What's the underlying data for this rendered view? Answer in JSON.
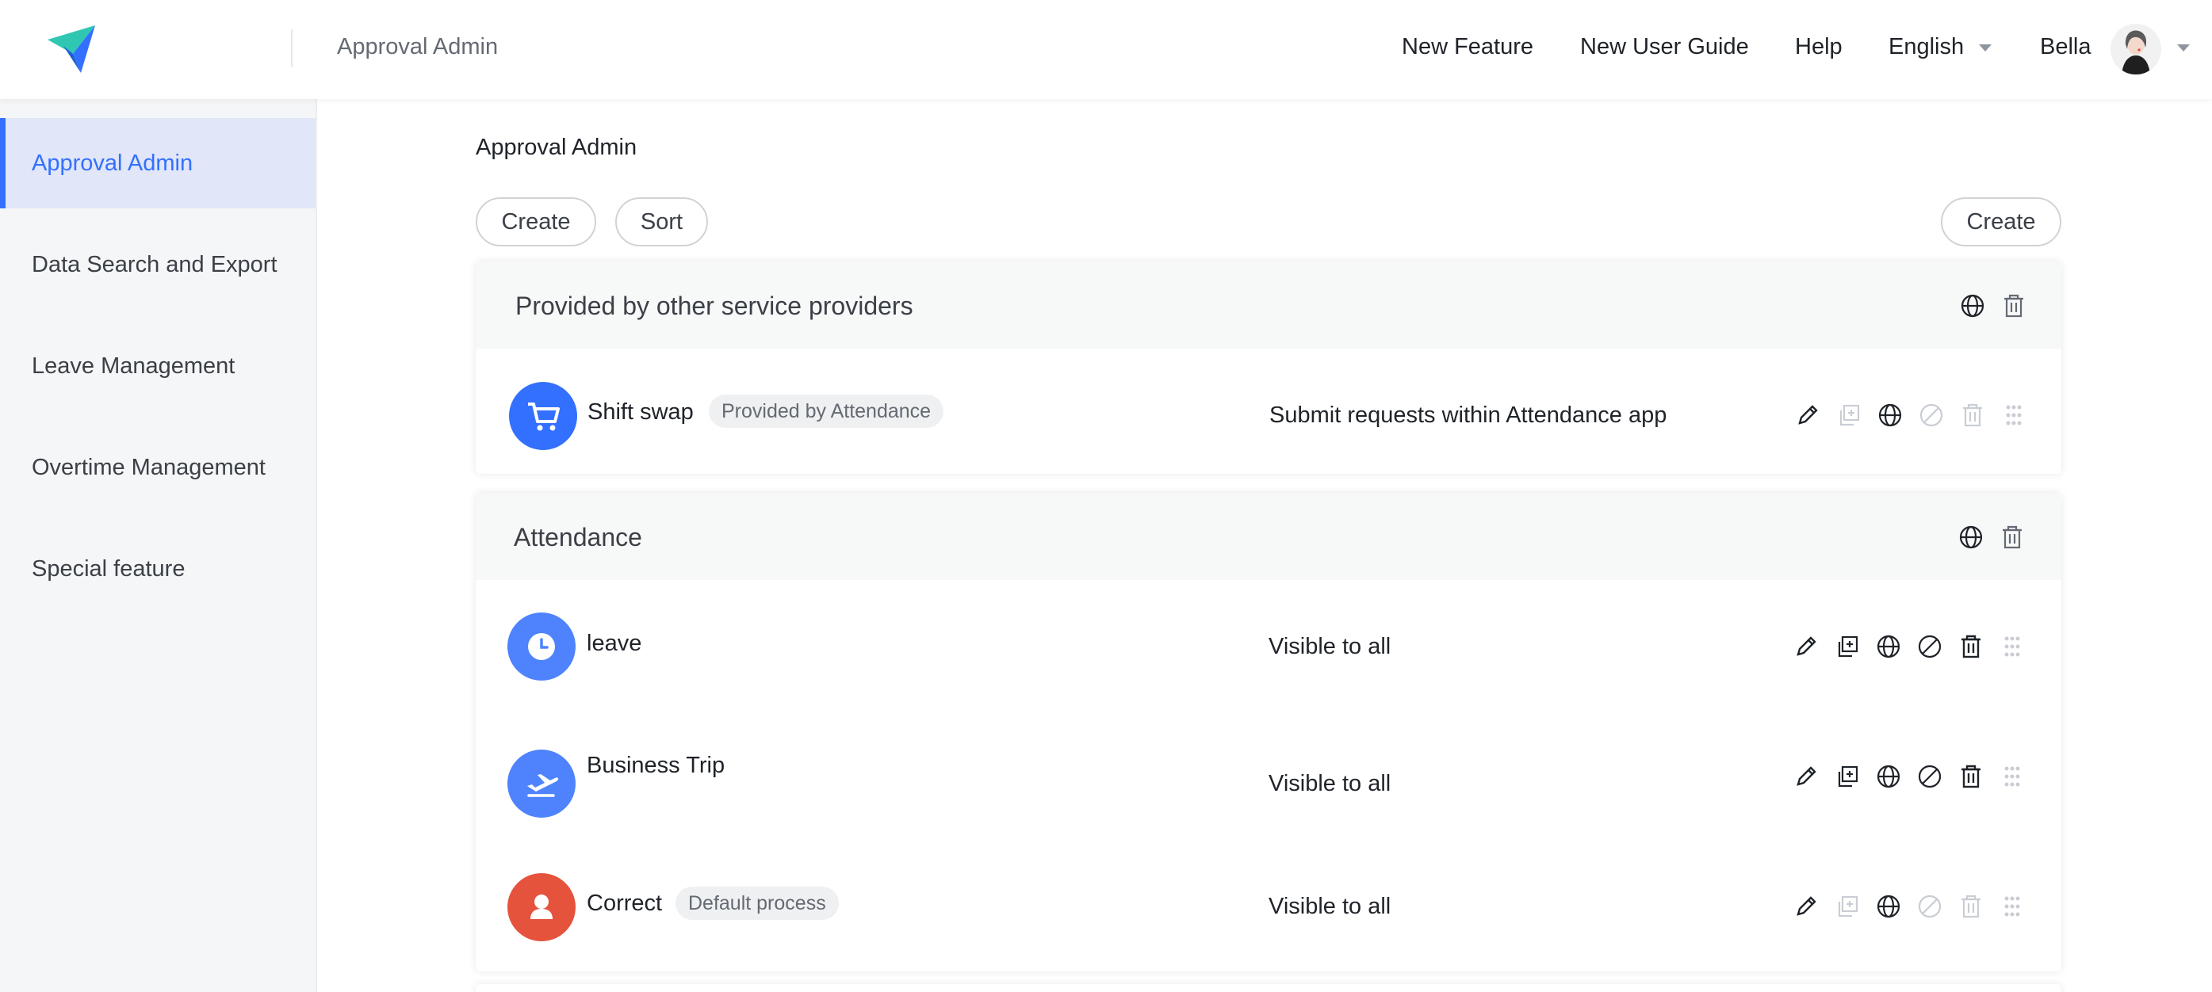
{
  "header": {
    "app_title": "Approval Admin",
    "nav": {
      "new_feature": "New Feature",
      "user_guide": "New User Guide",
      "help": "Help",
      "language": "English",
      "user_name": "Bella"
    }
  },
  "sidebar": {
    "items": [
      {
        "label": "Approval Admin",
        "active": true
      },
      {
        "label": "Data Search and Export",
        "active": false
      },
      {
        "label": "Leave Management",
        "active": false
      },
      {
        "label": "Overtime Management",
        "active": false
      },
      {
        "label": "Special feature",
        "active": false
      }
    ]
  },
  "main": {
    "breadcrumb": "Approval Admin",
    "toolbar": {
      "create_label": "Create",
      "sort_label": "Sort",
      "create_right_label": "Create"
    },
    "groups": [
      {
        "title": "Provided by other service providers",
        "rows": [
          {
            "name": "Shift swap",
            "tag": "Provided by Attendance",
            "visibility": "Submit requests within Attendance app",
            "icon": "cart-icon",
            "icon_color": "#3370ff"
          }
        ]
      },
      {
        "title": "Attendance",
        "rows": [
          {
            "name": "leave",
            "tag": "",
            "visibility": "Visible to all",
            "icon": "clock-icon",
            "icon_color": "#4e83fd"
          },
          {
            "name": "Business Trip",
            "tag": "",
            "visibility": "Visible to all",
            "icon": "plane-icon",
            "icon_color": "#4e83fd"
          },
          {
            "name": "Correct",
            "tag": "Default process",
            "visibility": "Visible to all",
            "icon": "person-icon",
            "icon_color": "#e5533d"
          }
        ]
      }
    ]
  },
  "colors": {
    "accent": "#3370ff",
    "sidebar_active_bg": "#e1e6f8",
    "disabled_icon": "#c9cdd4"
  }
}
